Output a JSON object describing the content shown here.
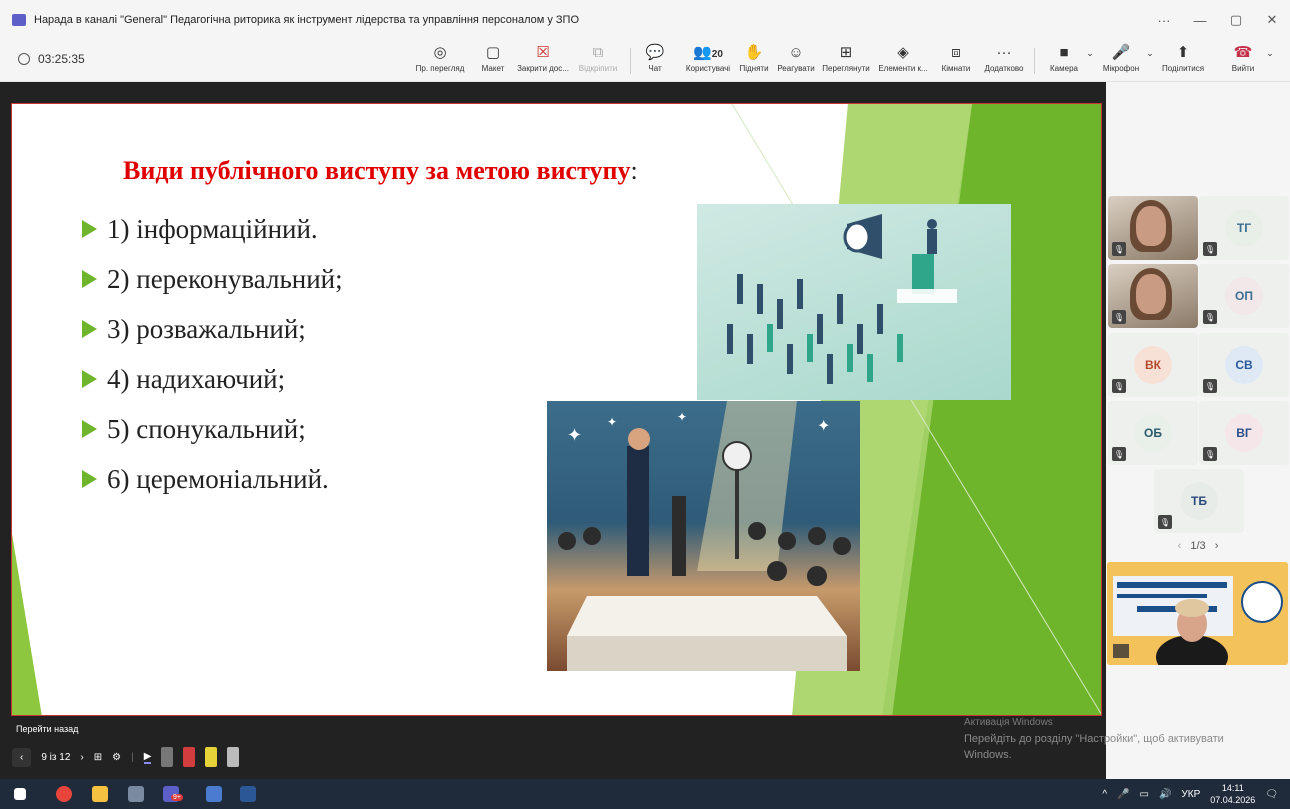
{
  "window": {
    "title": "Нарада в каналі \"General\" Педагогічна риторика як інструмент лідерства та управління персоналом у ЗПО",
    "controls": [
      "···",
      "—",
      "▢",
      "✕"
    ]
  },
  "toolbar": {
    "timer": "03:25:35",
    "buttons": [
      {
        "icon": "eye-icon",
        "glyph": "◎",
        "label": "Пр. перегляд"
      },
      {
        "icon": "layout-icon",
        "glyph": "▢",
        "label": "Макет"
      },
      {
        "icon": "close-box-icon",
        "glyph": "☒",
        "label": "Закрити дос..."
      },
      {
        "icon": "popout-icon",
        "glyph": "⧉",
        "label": "Відкріпити"
      },
      {
        "icon": "chat-icon",
        "glyph": "💬",
        "label": "Чат"
      },
      {
        "icon": "people-icon",
        "glyph": "👥",
        "label": "Користувачі",
        "count": "20"
      },
      {
        "icon": "hand-icon",
        "glyph": "✋",
        "label": "Підняти"
      },
      {
        "icon": "smile-icon",
        "glyph": "☺",
        "label": "Реагувати"
      },
      {
        "icon": "grid-icon",
        "glyph": "⊞",
        "label": "Переглянути"
      },
      {
        "icon": "apps-icon",
        "glyph": "◈",
        "label": "Елементи к..."
      },
      {
        "icon": "rooms-icon",
        "glyph": "⧈",
        "label": "Кімнати"
      },
      {
        "icon": "more-icon",
        "glyph": "···",
        "label": "Додатково"
      },
      {
        "icon": "camera-icon",
        "glyph": "■",
        "label": "Камера"
      },
      {
        "icon": "mic-icon",
        "glyph": "🎤",
        "label": "Мікрофон"
      },
      {
        "icon": "share-icon",
        "glyph": "⬆",
        "label": "Поділитися"
      },
      {
        "icon": "hangup-icon",
        "glyph": "☎",
        "label": "Вийти"
      }
    ]
  },
  "slide": {
    "title": "Види публічного виступу за метою виступу",
    "title_suffix": ":",
    "items": [
      "1) інформаційний.",
      "2) переконувальний;",
      "3) розважальний;",
      "4) надихаючий;",
      "5) спонукальний;",
      "6) церемоніальний."
    ]
  },
  "participants": [
    {
      "initials": "",
      "photo": true
    },
    {
      "initials": "ТГ",
      "color": "#3c6e8f",
      "bg": "#e8efe8"
    },
    {
      "initials": "",
      "photo": true
    },
    {
      "initials": "ОП",
      "color": "#3c6e8f",
      "bg": "#f2e8ea"
    },
    {
      "initials": "ВК",
      "color": "#b44a2a",
      "bg": "#f7e0d6"
    },
    {
      "initials": "СВ",
      "color": "#2a5a9a",
      "bg": "#dfe8f5"
    },
    {
      "initials": "ОБ",
      "color": "#2a5a6a",
      "bg": "#e9efe9"
    },
    {
      "initials": "ВГ",
      "color": "#2a4e8a",
      "bg": "#f5e6ea"
    },
    {
      "initials": "ТБ",
      "color": "#2a4a7a",
      "bg": "#e8ece8"
    }
  ],
  "pager": "1/3",
  "bottom": {
    "go_back": "Перейти назад",
    "slide_counter": "9 із 12"
  },
  "watermark": {
    "line1": "Активація Windows",
    "line2": "Перейдіть до розділу \"Настройки\", щоб активувати",
    "line3": "Windows."
  },
  "taskbar": {
    "lang": "УКР",
    "time": "14:11",
    "date": "07.04.2026",
    "notif": "9+"
  }
}
